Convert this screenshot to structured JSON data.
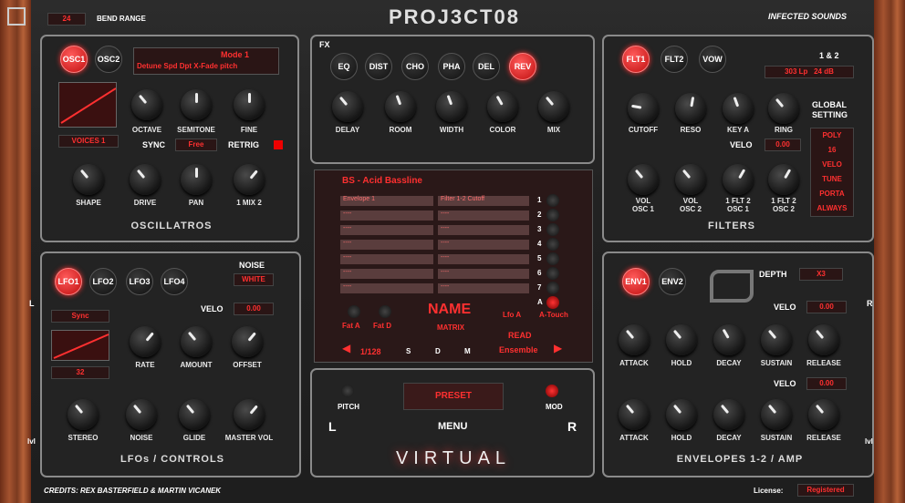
{
  "header": {
    "bend_value": "24",
    "bend_label": "BEND RANGE",
    "logo": "PROJ3CT08",
    "brand": "INFECTED SOUNDS"
  },
  "osc": {
    "b1": "OSC1",
    "b2": "OSC2",
    "modes": [
      "Detune",
      "Spd",
      "Dpt",
      "X-Fade",
      "pitch"
    ],
    "mode": "Mode 1",
    "knobs1": [
      "OCTAVE",
      "SEMITONE",
      "FINE"
    ],
    "voices": "VOICES 1",
    "sync": "SYNC",
    "free": "Free",
    "retrig": "RETRIG",
    "knobs2": [
      "SHAPE",
      "DRIVE",
      "PAN",
      "1 MIX 2"
    ],
    "title": "OSCILLATROS"
  },
  "fx": {
    "label": "FX",
    "btns": [
      "EQ",
      "DIST",
      "CHO",
      "PHA",
      "DEL",
      "REV"
    ],
    "knobs": [
      "DELAY",
      "ROOM",
      "WIDTH",
      "COLOR",
      "MIX"
    ]
  },
  "flt": {
    "btns": [
      "FLT1",
      "FLT2",
      "VOW"
    ],
    "one_two": "1 & 2",
    "type": "303 Lp",
    "db": "24 dB",
    "global": "GLOBAL",
    "setting": "SETTING",
    "knobs1": [
      "CUTOFF",
      "RESO",
      "KEY A",
      "RING"
    ],
    "velo": "VELO",
    "velo_val": "0.00",
    "knobs2a": [
      "VOL",
      "VOL",
      "1 FLT 2",
      "1 FLT 2"
    ],
    "knobs2b": [
      "OSC 1",
      "OSC 2",
      "OSC 1",
      "OSC 2"
    ],
    "settings": [
      "POLY",
      "16",
      "VELO",
      "TUNE",
      "PORTA",
      "ALWAYS"
    ],
    "title": "FILTERS"
  },
  "matrix": {
    "preset": "BS - Acid Bassline",
    "src": [
      "Envelope 1",
      "----",
      "----",
      "----",
      "----",
      "----",
      "----"
    ],
    "dst": [
      "Filter 1-2 Cutoff",
      "----",
      "----",
      "----",
      "----",
      "----",
      "----"
    ],
    "nums": [
      "1",
      "2",
      "3",
      "4",
      "5",
      "6",
      "7",
      "A"
    ],
    "fata": "Fat A",
    "fatd": "Fat D",
    "name": "NAME",
    "mlabel": "MATRIX",
    "lfoa": "Lfo A",
    "atouch": "A-Touch",
    "page": "1/128",
    "s": "S",
    "d": "D",
    "m": "M",
    "read": "READ",
    "ens": "Ensemble"
  },
  "lfo": {
    "btns": [
      "LFO1",
      "LFO2",
      "LFO3",
      "LFO4"
    ],
    "noise": "NOISE",
    "white": "WHITE",
    "velo": "VELO",
    "velo_val": "0.00",
    "sync": "Sync",
    "rate_val": "32",
    "knobs1": [
      "RATE",
      "AMOUNT",
      "OFFSET"
    ],
    "knobs2": [
      "STEREO",
      "NOISE",
      "GLIDE",
      "MASTER VOL"
    ],
    "title": "LFOs / CONTROLS"
  },
  "menu": {
    "pitch": "PITCH",
    "preset": "PRESET",
    "mod": "MOD",
    "menu": "MENU",
    "l": "L",
    "r": "R",
    "virtual": "VIRTUAL"
  },
  "env": {
    "btns": [
      "ENV1",
      "ENV2"
    ],
    "depth": "DEPTH",
    "depth_val": "X3",
    "velo": "VELO",
    "velo_val": "0.00",
    "knobs": [
      "ATTACK",
      "HOLD",
      "DECAY",
      "SUSTAIN",
      "RELEASE"
    ],
    "title": "ENVELOPES 1-2 / AMP"
  },
  "side": {
    "l": "L",
    "r": "R",
    "lvl": "lvl"
  },
  "footer": {
    "credits": "CREDITS: REX BASTERFIELD & MARTIN VICANEK",
    "license": "License:",
    "reg": "Registered"
  }
}
